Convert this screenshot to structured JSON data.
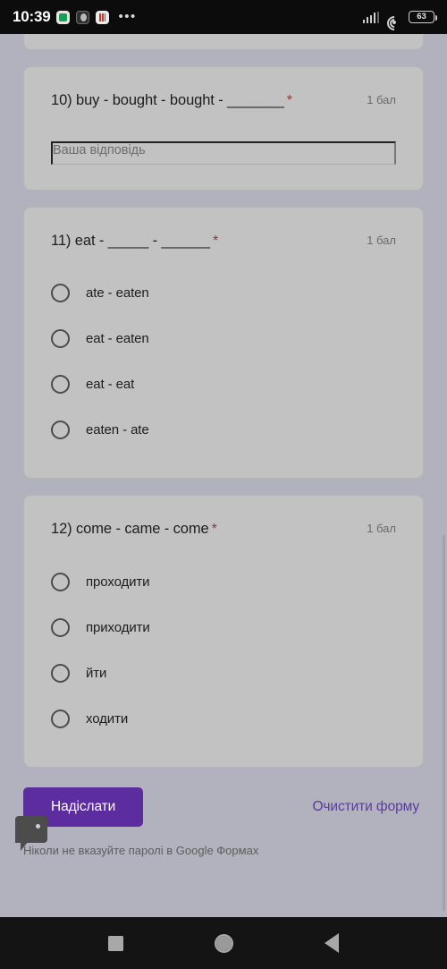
{
  "status_bar": {
    "time": "10:39",
    "app_icons": [
      "green-app-icon",
      "dark-circle-app-icon",
      "chart-app-icon"
    ],
    "overflow": "•••",
    "battery_percent": "63",
    "signal_icon": "cellular-signal-icon",
    "wifi_icon": "wifi-icon"
  },
  "form": {
    "questions": [
      {
        "title": "10) buy - bought - bought - _______",
        "required_marker": "*",
        "points": "1 бал",
        "type": "short-answer",
        "answer_placeholder": "Ваша відповідь",
        "answer_value": ""
      },
      {
        "title": "11) eat - _____ - ______",
        "required_marker": "*",
        "points": "1 бал",
        "type": "radio",
        "options": [
          "ate - eaten",
          "eat - eaten",
          "eat - eat",
          "eaten - ate"
        ]
      },
      {
        "title": "12) come - came - come",
        "required_marker": "*",
        "points": "1 бал",
        "type": "radio",
        "options": [
          "проходити",
          "приходити",
          "йти",
          "ходити"
        ]
      }
    ],
    "submit_label": "Надіслати",
    "clear_label": "Очистити форму",
    "footer_note": "Ніколи не вказуйте паролі в Google Формах"
  },
  "nav_bar": {
    "recents": "recents-square-icon",
    "home": "home-circle-icon",
    "back": "back-triangle-icon"
  },
  "colors": {
    "page_background": "#b2b2be",
    "card_background": "#c2c2c2",
    "submit_button": "#5b2d9e",
    "link_purple": "#5b3aa0",
    "required_asterisk": "#93352f"
  }
}
